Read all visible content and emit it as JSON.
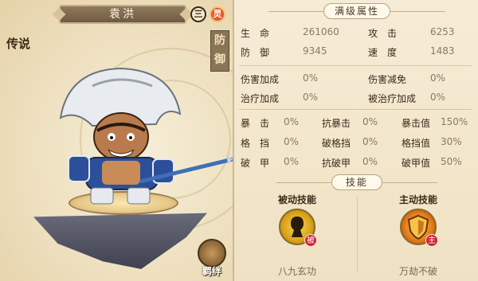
{
  "hero": {
    "name": "袁洪",
    "rank_badge": "三",
    "spirit_badge": "灵",
    "rarity": "传说",
    "role": "防御",
    "fetter_label": "羁绊"
  },
  "attributes": {
    "title": "满级属性",
    "primary": [
      {
        "label": "生　命",
        "value": "261060"
      },
      {
        "label": "攻　击",
        "value": "6253"
      },
      {
        "label": "防　御",
        "value": "9345"
      },
      {
        "label": "速　度",
        "value": "1483"
      }
    ],
    "secondary": [
      {
        "label": "伤害加成",
        "value": "0%"
      },
      {
        "label": "伤害减免",
        "value": "0%"
      },
      {
        "label": "治疗加成",
        "value": "0%"
      },
      {
        "label": "被治疗加成",
        "value": "0%"
      }
    ],
    "tertiary": [
      {
        "label": "暴　击",
        "value": "0%"
      },
      {
        "label": "抗暴击",
        "value": "0%"
      },
      {
        "label": "暴击值",
        "value": "150%"
      },
      {
        "label": "格　挡",
        "value": "0%"
      },
      {
        "label": "破格挡",
        "value": "0%"
      },
      {
        "label": "格挡值",
        "value": "30%"
      },
      {
        "label": "破　甲",
        "value": "0%"
      },
      {
        "label": "抗破甲",
        "value": "0%"
      },
      {
        "label": "破甲值",
        "value": "50%"
      }
    ]
  },
  "skills": {
    "title": "技能",
    "passive": {
      "header": "被动技能",
      "tag": "被",
      "name": "八九玄功"
    },
    "active": {
      "header": "主动技能",
      "tag": "主",
      "name": "万劫不破"
    }
  }
}
